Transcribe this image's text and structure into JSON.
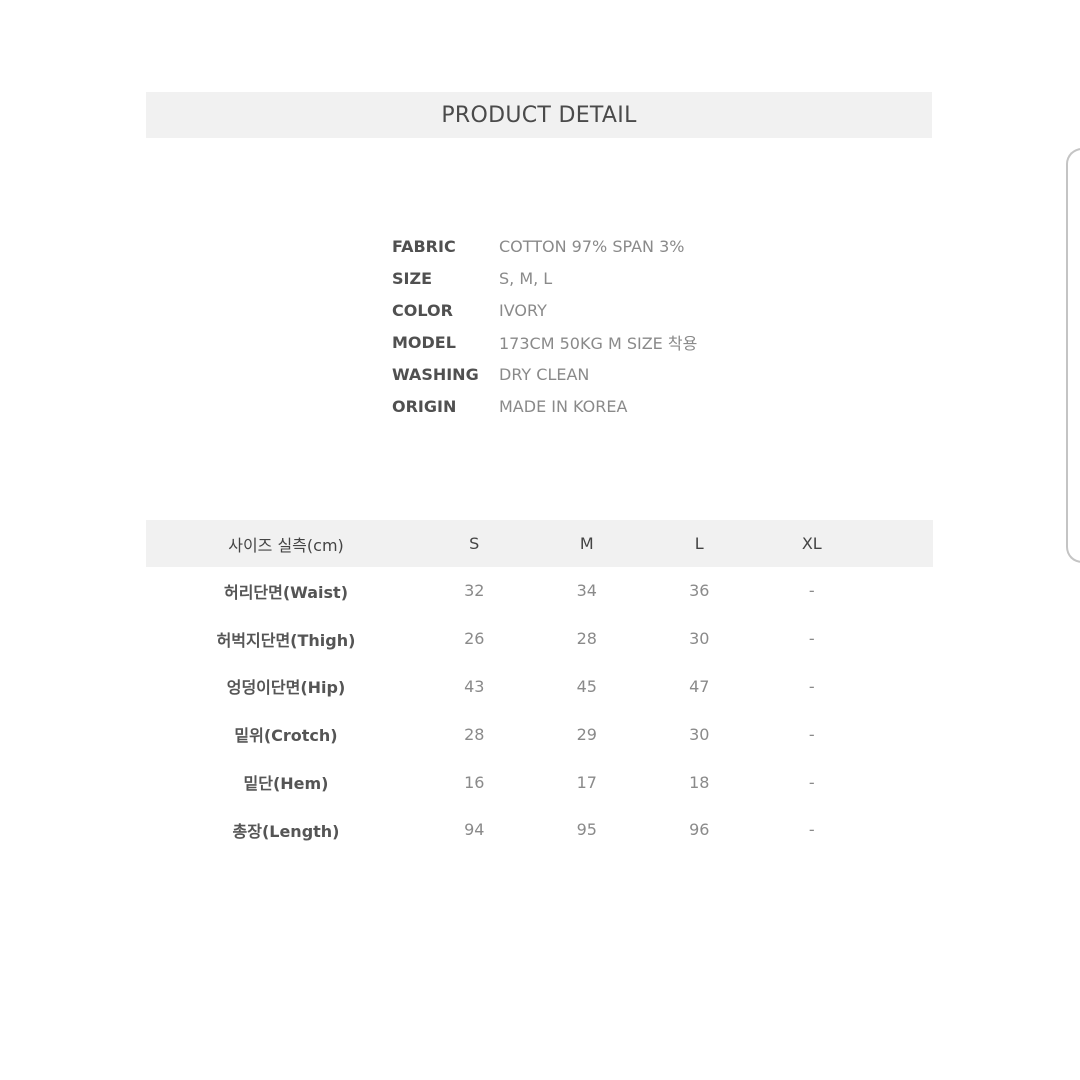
{
  "header": {
    "title": "PRODUCT DETAIL"
  },
  "specs": [
    {
      "label": "FABRIC",
      "value": "COTTON 97% SPAN 3%"
    },
    {
      "label": "SIZE",
      "value": "S, M, L"
    },
    {
      "label": "COLOR",
      "value": "IVORY"
    },
    {
      "label": "MODEL",
      "value": "173CM 50KG M SIZE 착용"
    },
    {
      "label": "WASHING",
      "value": "DRY CLEAN"
    },
    {
      "label": "ORIGIN",
      "value": "MADE IN KOREA"
    }
  ],
  "size_table": {
    "header": {
      "label": "사이즈 실측(cm)",
      "columns": [
        "S",
        "M",
        "L",
        "XL"
      ]
    },
    "rows": [
      {
        "label": "허리단면(Waist)",
        "values": [
          "32",
          "34",
          "36",
          "-"
        ]
      },
      {
        "label": "허벅지단면(Thigh)",
        "values": [
          "26",
          "28",
          "30",
          "-"
        ]
      },
      {
        "label": "엉덩이단면(Hip)",
        "values": [
          "43",
          "45",
          "47",
          "-"
        ]
      },
      {
        "label": "밑위(Crotch)",
        "values": [
          "28",
          "29",
          "30",
          "-"
        ]
      },
      {
        "label": "밑단(Hem)",
        "values": [
          "16",
          "17",
          "18",
          "-"
        ]
      },
      {
        "label": "총장(Length)",
        "values": [
          "94",
          "95",
          "96",
          "-"
        ]
      }
    ]
  }
}
